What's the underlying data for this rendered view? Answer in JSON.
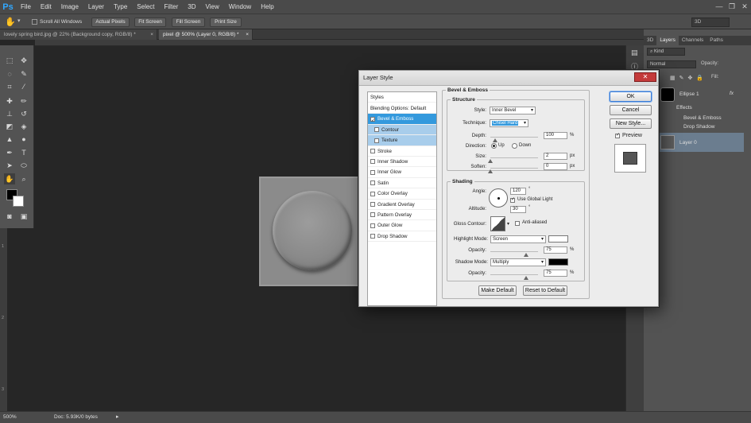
{
  "app": {
    "logo": "Ps"
  },
  "menubar": {
    "items": [
      "File",
      "Edit",
      "Image",
      "Layer",
      "Type",
      "Select",
      "Filter",
      "3D",
      "View",
      "Window",
      "Help"
    ]
  },
  "window_controls": {
    "minimize": "—",
    "restore": "❐",
    "close": "✕"
  },
  "options_bar": {
    "tool_icon": "hand-icon",
    "scroll_all_windows": "Scroll All Windows",
    "buttons": [
      "Actual Pixels",
      "Fit Screen",
      "Fill Screen",
      "Print Size"
    ],
    "workspace": "3D"
  },
  "tabs": [
    {
      "label": "lovely spring bird.jpg @ 22% (Background copy, RGB/8) *",
      "close": "×"
    },
    {
      "label": "pixel @ 500% (Layer 0, RGB/8) *",
      "close": "×"
    }
  ],
  "rulers": {
    "left_marks": [
      "1",
      "2",
      "3"
    ]
  },
  "status": {
    "zoom": "500%",
    "doc": "Doc: 5.93K/0 bytes"
  },
  "right_panel": {
    "tabs": [
      "3D",
      "Layers",
      "Channels",
      "Paths"
    ],
    "kind_label": "Kind",
    "blend_mode": "Normal",
    "opacity_label": "Opacity:",
    "fill_label": "Fill:",
    "layers": {
      "ellipse": "Ellipse 1",
      "fx": "fx",
      "effects": "Effects",
      "effect1": "Bevel & Emboss",
      "effect2": "Drop Shadow",
      "layer0": "Layer 0"
    }
  },
  "dialog": {
    "title": "Layer Style",
    "close": "✕",
    "styles_header": "Styles",
    "styles": [
      {
        "label": "Blending Options: Default",
        "checkbox": false,
        "state": "normal"
      },
      {
        "label": "Bevel & Emboss",
        "checkbox": true,
        "checked": true,
        "state": "selected"
      },
      {
        "label": "Contour",
        "checkbox": true,
        "checked": false,
        "state": "sub"
      },
      {
        "label": "Texture",
        "checkbox": true,
        "checked": false,
        "state": "sub"
      },
      {
        "label": "Stroke",
        "checkbox": true,
        "checked": false,
        "state": "normal"
      },
      {
        "label": "Inner Shadow",
        "checkbox": true,
        "checked": false,
        "state": "normal"
      },
      {
        "label": "Inner Glow",
        "checkbox": true,
        "checked": false,
        "state": "normal"
      },
      {
        "label": "Satin",
        "checkbox": true,
        "checked": false,
        "state": "normal"
      },
      {
        "label": "Color Overlay",
        "checkbox": true,
        "checked": false,
        "state": "normal"
      },
      {
        "label": "Gradient Overlay",
        "checkbox": true,
        "checked": false,
        "state": "normal"
      },
      {
        "label": "Pattern Overlay",
        "checkbox": true,
        "checked": false,
        "state": "normal"
      },
      {
        "label": "Outer Glow",
        "checkbox": true,
        "checked": false,
        "state": "normal"
      },
      {
        "label": "Drop Shadow",
        "checkbox": true,
        "checked": false,
        "state": "normal"
      }
    ],
    "section_title": "Bevel & Emboss",
    "structure": {
      "title": "Structure",
      "style_label": "Style:",
      "style_value": "Inner Bevel",
      "technique_label": "Technique:",
      "technique_value": "Chisel Hard",
      "depth_label": "Depth:",
      "depth_value": "100",
      "depth_unit": "%",
      "depth_level": 100,
      "direction_label": "Direction:",
      "direction_up": "Up",
      "direction_down": "Down",
      "direction_selected": "Up",
      "size_label": "Size:",
      "size_value": "2",
      "size_unit": "px",
      "size_level": 2,
      "soften_label": "Soften:",
      "soften_value": "0",
      "soften_unit": "px",
      "soften_level": 0
    },
    "shading": {
      "title": "Shading",
      "angle_label": "Angle:",
      "angle_value": "120",
      "angle_unit": "°",
      "global_light_label": "Use Global Light",
      "global_light_checked": true,
      "altitude_label": "Altitude:",
      "altitude_value": "30",
      "altitude_unit": "°",
      "gloss_label": "Gloss Contour:",
      "anti_aliased_label": "Anti-aliased",
      "anti_aliased_checked": false,
      "highlight_mode_label": "Highlight Mode:",
      "highlight_mode_value": "Screen",
      "highlight_color": "#ffffff",
      "highlight_opacity_label": "Opacity:",
      "highlight_opacity_value": "75",
      "highlight_opacity_unit": "%",
      "highlight_opacity_level": 75,
      "shadow_mode_label": "Shadow Mode:",
      "shadow_mode_value": "Multiply",
      "shadow_color": "#000000",
      "shadow_opacity_label": "Opacity:",
      "shadow_opacity_value": "75",
      "shadow_opacity_unit": "%",
      "shadow_opacity_level": 75
    },
    "make_default": "Make Default",
    "reset_default": "Reset to Default",
    "ok": "OK",
    "cancel": "Cancel",
    "new_style": "New Style...",
    "preview_label": "Preview",
    "preview_checked": true
  },
  "colors": {
    "accent": "#3399dd",
    "ps_blue": "#31a8ff",
    "selected_layer": "#6b7d8f"
  }
}
